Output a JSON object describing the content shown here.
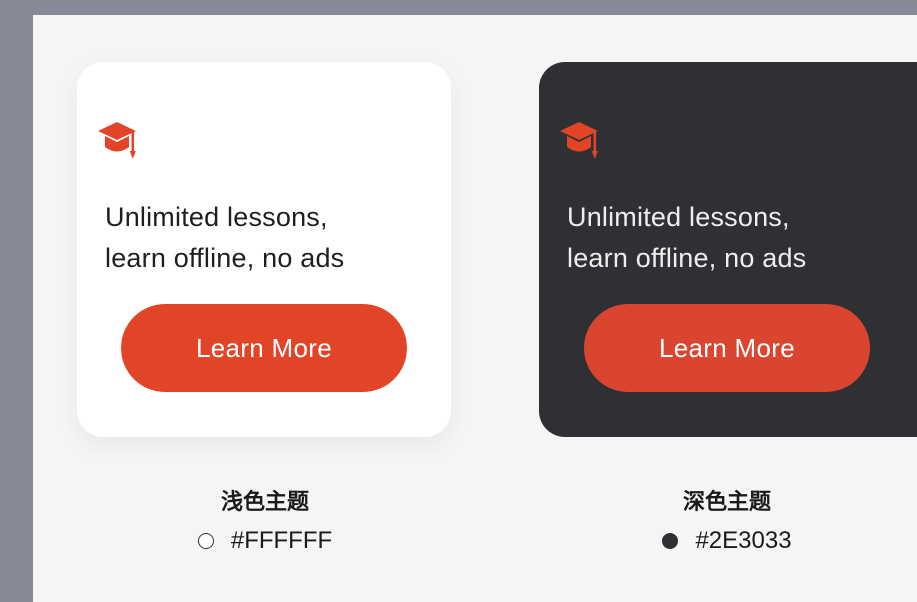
{
  "colors": {
    "accent": "#E24428",
    "light_bg": "#FFFFFF",
    "dark_bg": "#2E3033",
    "page_bg": "#F5F5F5",
    "frame_bg": "#858A96"
  },
  "cards": {
    "light": {
      "icon": "graduation-cap-icon",
      "line1": "Unlimited lessons,",
      "line2": "learn offline, no ads",
      "button": "Learn More"
    },
    "dark": {
      "icon": "graduation-cap-icon",
      "line1": "Unlimited lessons,",
      "line2": "learn offline, no ads",
      "button": "Learn More"
    }
  },
  "themes": {
    "light": {
      "name": "浅色主题",
      "hex": "#FFFFFF"
    },
    "dark": {
      "name": "深色主题",
      "hex": "#2E3033"
    }
  }
}
